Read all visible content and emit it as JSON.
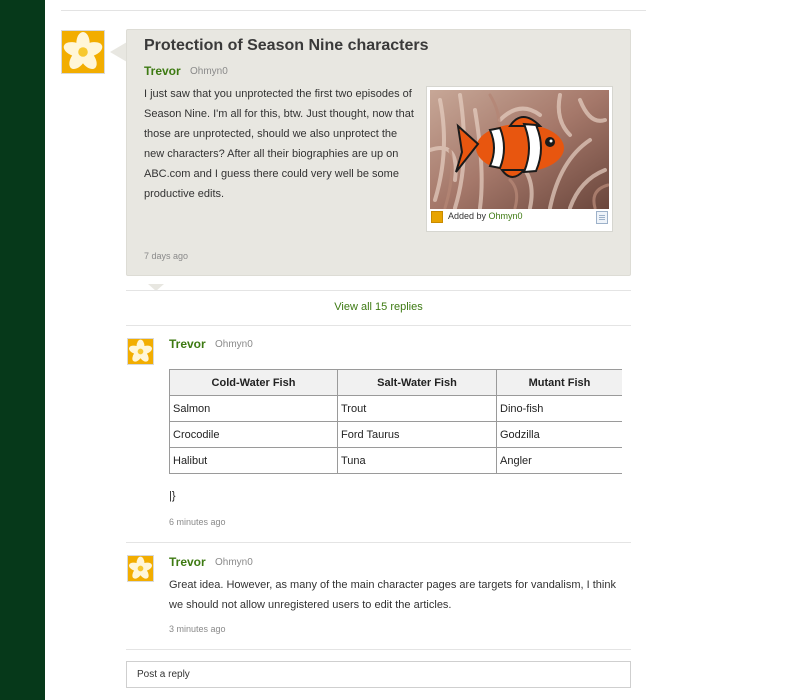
{
  "thread": {
    "title": "Protection of Season Nine characters",
    "author": "Trevor",
    "handle": "Ohmyn0",
    "body": "I just saw that you unprotected the first two episodes of Season Nine. I'm all for this, btw. Just thought, now that those are unprotected, should we also unprotect the new characters? After all their biographies are up on ABC.com and I guess there could very well be some productive edits.",
    "timestamp": "7 days ago",
    "media": {
      "added_by_label": "Added by",
      "added_by_user": "Ohmyn0",
      "image_icon": "clownfish-photo",
      "info_icon": "file-info-icon"
    }
  },
  "view_all_replies": "View all 15 replies",
  "replies": [
    {
      "author": "Trevor",
      "handle": "Ohmyn0",
      "table": {
        "headers": [
          "Cold-Water Fish",
          "Salt-Water Fish",
          "Mutant Fish"
        ],
        "rows": [
          [
            "Salmon",
            "Trout",
            "Dino-fish"
          ],
          [
            "Crocodile",
            "Ford Taurus",
            "Godzilla"
          ],
          [
            "Halibut",
            "Tuna",
            "Angler"
          ]
        ]
      },
      "trailing_text": "|}",
      "timestamp": "6 minutes ago"
    },
    {
      "author": "Trevor",
      "handle": "Ohmyn0",
      "body": "Great idea. However, as many of the main character pages are targets for vandalism, I think we should not allow unregistered users to edit the articles.",
      "timestamp": "3 minutes ago"
    }
  ],
  "reply_box": {
    "placeholder": "Post a reply"
  },
  "colors": {
    "rail": "#06391a",
    "author_green": "#3d7a12",
    "bubble_bg": "#e8e7e1"
  }
}
